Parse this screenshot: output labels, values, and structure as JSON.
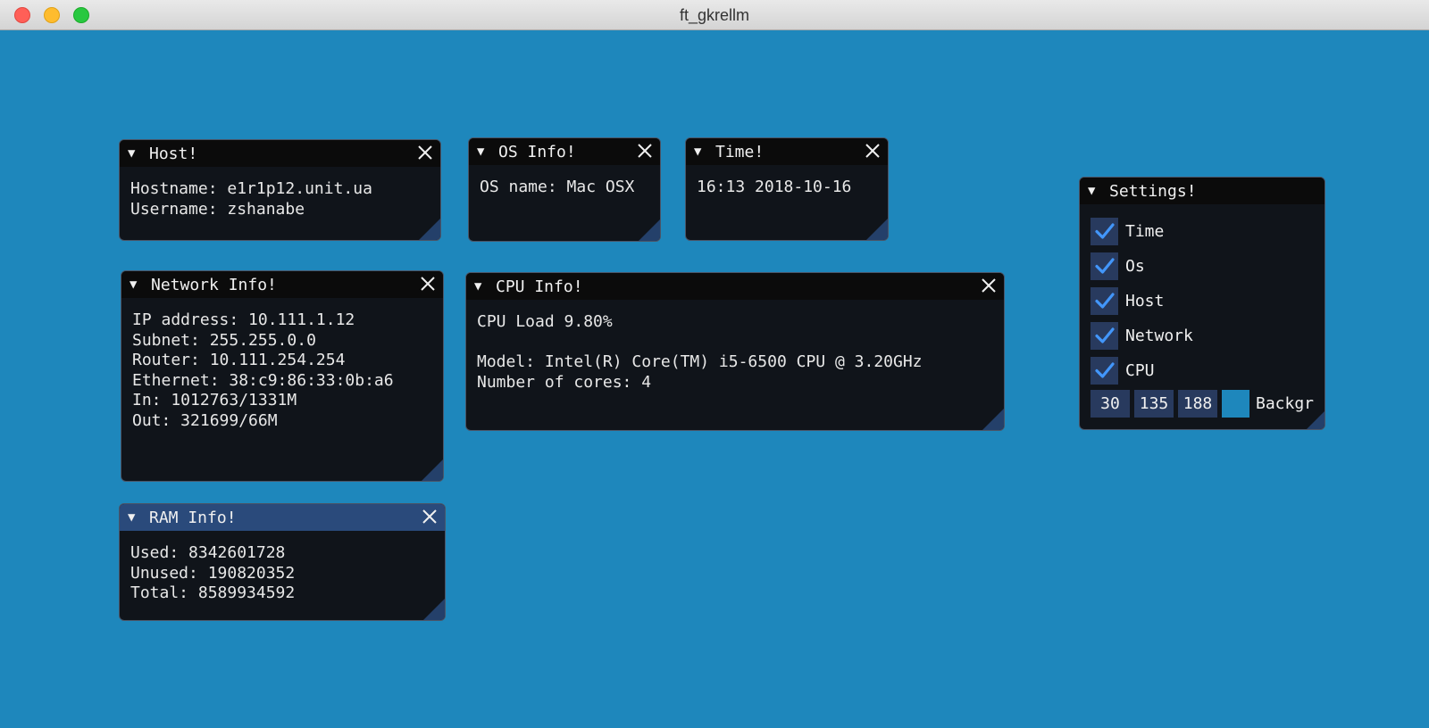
{
  "window": {
    "title": "ft_gkrellm",
    "background_color": "#1e87bc"
  },
  "panels": {
    "host": {
      "title": "Host!",
      "lines": [
        "Hostname: e1r1p12.unit.ua",
        "Username: zshanabe"
      ]
    },
    "os": {
      "title": "OS Info!",
      "lines": [
        "OS name: Mac OSX"
      ]
    },
    "time": {
      "title": "Time!",
      "lines": [
        "16:13 2018-10-16"
      ]
    },
    "network": {
      "title": "Network Info!",
      "lines": [
        "IP address: 10.111.1.12",
        "Subnet: 255.255.0.0",
        "Router: 10.111.254.254",
        "Ethernet: 38:c9:86:33:0b:a6",
        "In: 1012763/1331M",
        "Out: 321699/66M"
      ]
    },
    "cpu": {
      "title": "CPU Info!",
      "lines": [
        "CPU Load 9.80%",
        "",
        "Model: Intel(R) Core(TM) i5-6500 CPU @ 3.20GHz",
        "Number of cores: 4"
      ]
    },
    "ram": {
      "title": "RAM Info!",
      "lines": [
        "Used: 8342601728",
        "Unused: 190820352",
        "Total: 8589934592"
      ]
    },
    "settings": {
      "title": "Settings!",
      "checkboxes": [
        {
          "label": "Time",
          "checked": true
        },
        {
          "label": "Os",
          "checked": true
        },
        {
          "label": "Host",
          "checked": true
        },
        {
          "label": "Network",
          "checked": true
        },
        {
          "label": "CPU",
          "checked": true
        }
      ],
      "color": {
        "r": "30",
        "g": "135",
        "b": "188",
        "label": "Backgr"
      }
    }
  },
  "colors": {
    "panel_bg": "#10141a",
    "title_bg": "#0b0b0b",
    "active_title_bg": "#2a4a7b",
    "checkbox_bg": "#283a5e",
    "checkmark": "#4296fa"
  }
}
